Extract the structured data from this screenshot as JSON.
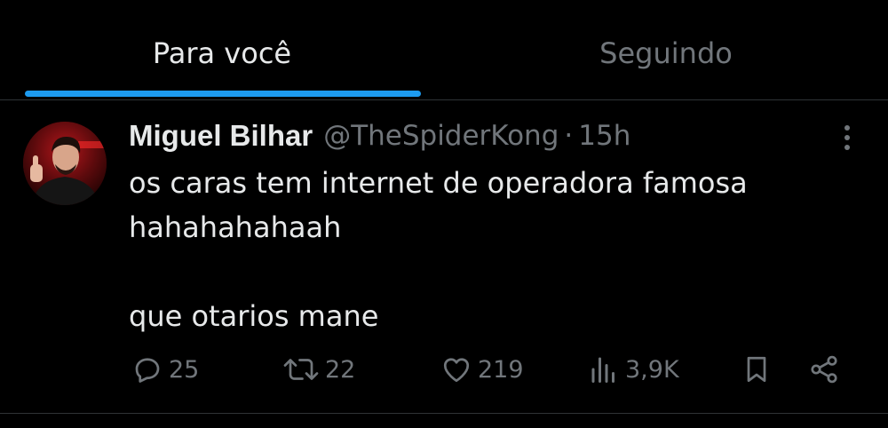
{
  "tabs": [
    {
      "label": "Para você",
      "selected": true
    },
    {
      "label": "Seguindo",
      "selected": false
    }
  ],
  "colors": {
    "accent": "#1d9bf0",
    "background": "#000000",
    "text_primary": "#e7e9ea",
    "text_secondary": "#71767b",
    "divider": "#2f3336"
  },
  "tweet": {
    "author": {
      "display_name": "Miguel Bilhar",
      "handle": "@TheSpiderKong",
      "avatar_icon": "profile-photo"
    },
    "separator": "·",
    "time": "15h",
    "text": "os caras tem internet de operadora famosa\nhahahahahaah\n\nque otarios mane",
    "actions": {
      "replies": {
        "icon": "reply-icon",
        "count": "25"
      },
      "retweets": {
        "icon": "retweet-icon",
        "count": "22"
      },
      "likes": {
        "icon": "heart-icon",
        "count": "219"
      },
      "views": {
        "icon": "views-icon",
        "count": "3,9K"
      },
      "bookmark": {
        "icon": "bookmark-icon"
      },
      "share": {
        "icon": "share-icon"
      }
    },
    "more_icon": "more-vertical-icon"
  }
}
